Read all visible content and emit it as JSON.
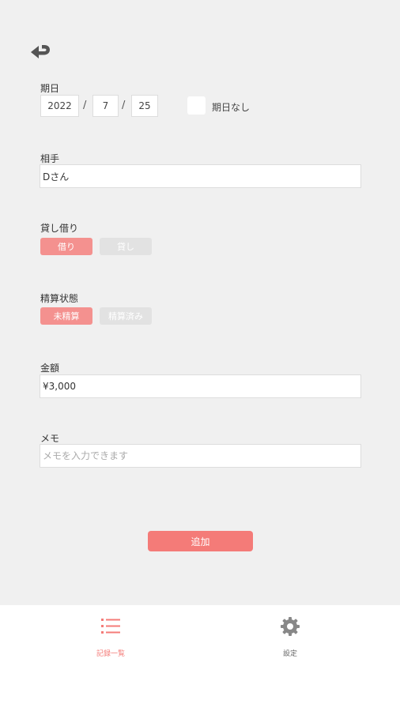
{
  "date": {
    "label": "期日",
    "year": "2022",
    "month": "7",
    "day": "25",
    "separator": "/",
    "no_date_label": "期日なし"
  },
  "partner": {
    "label": "相手",
    "value": "Dさん"
  },
  "lend_borrow": {
    "label": "貸し借り",
    "options": [
      "借り",
      "貸し"
    ],
    "selected": "借り"
  },
  "settlement": {
    "label": "精算状態",
    "options": [
      "未精算",
      "精算済み"
    ],
    "selected": "未精算"
  },
  "amount": {
    "label": "金額",
    "value": "¥3,000"
  },
  "memo": {
    "label": "メモ",
    "value": "",
    "placeholder": "メモを入力できます"
  },
  "add_button": "追加",
  "tabs": {
    "list_label": "記録一覧",
    "settings_label": "設定"
  },
  "colors": {
    "accent": "#f47b78",
    "segment_active": "#f4918f",
    "segment_inactive": "#e2e2e2",
    "icon_inactive": "#888888"
  },
  "icons": {
    "back": "return-arrow-icon",
    "list": "list-icon",
    "settings": "gear-icon"
  }
}
